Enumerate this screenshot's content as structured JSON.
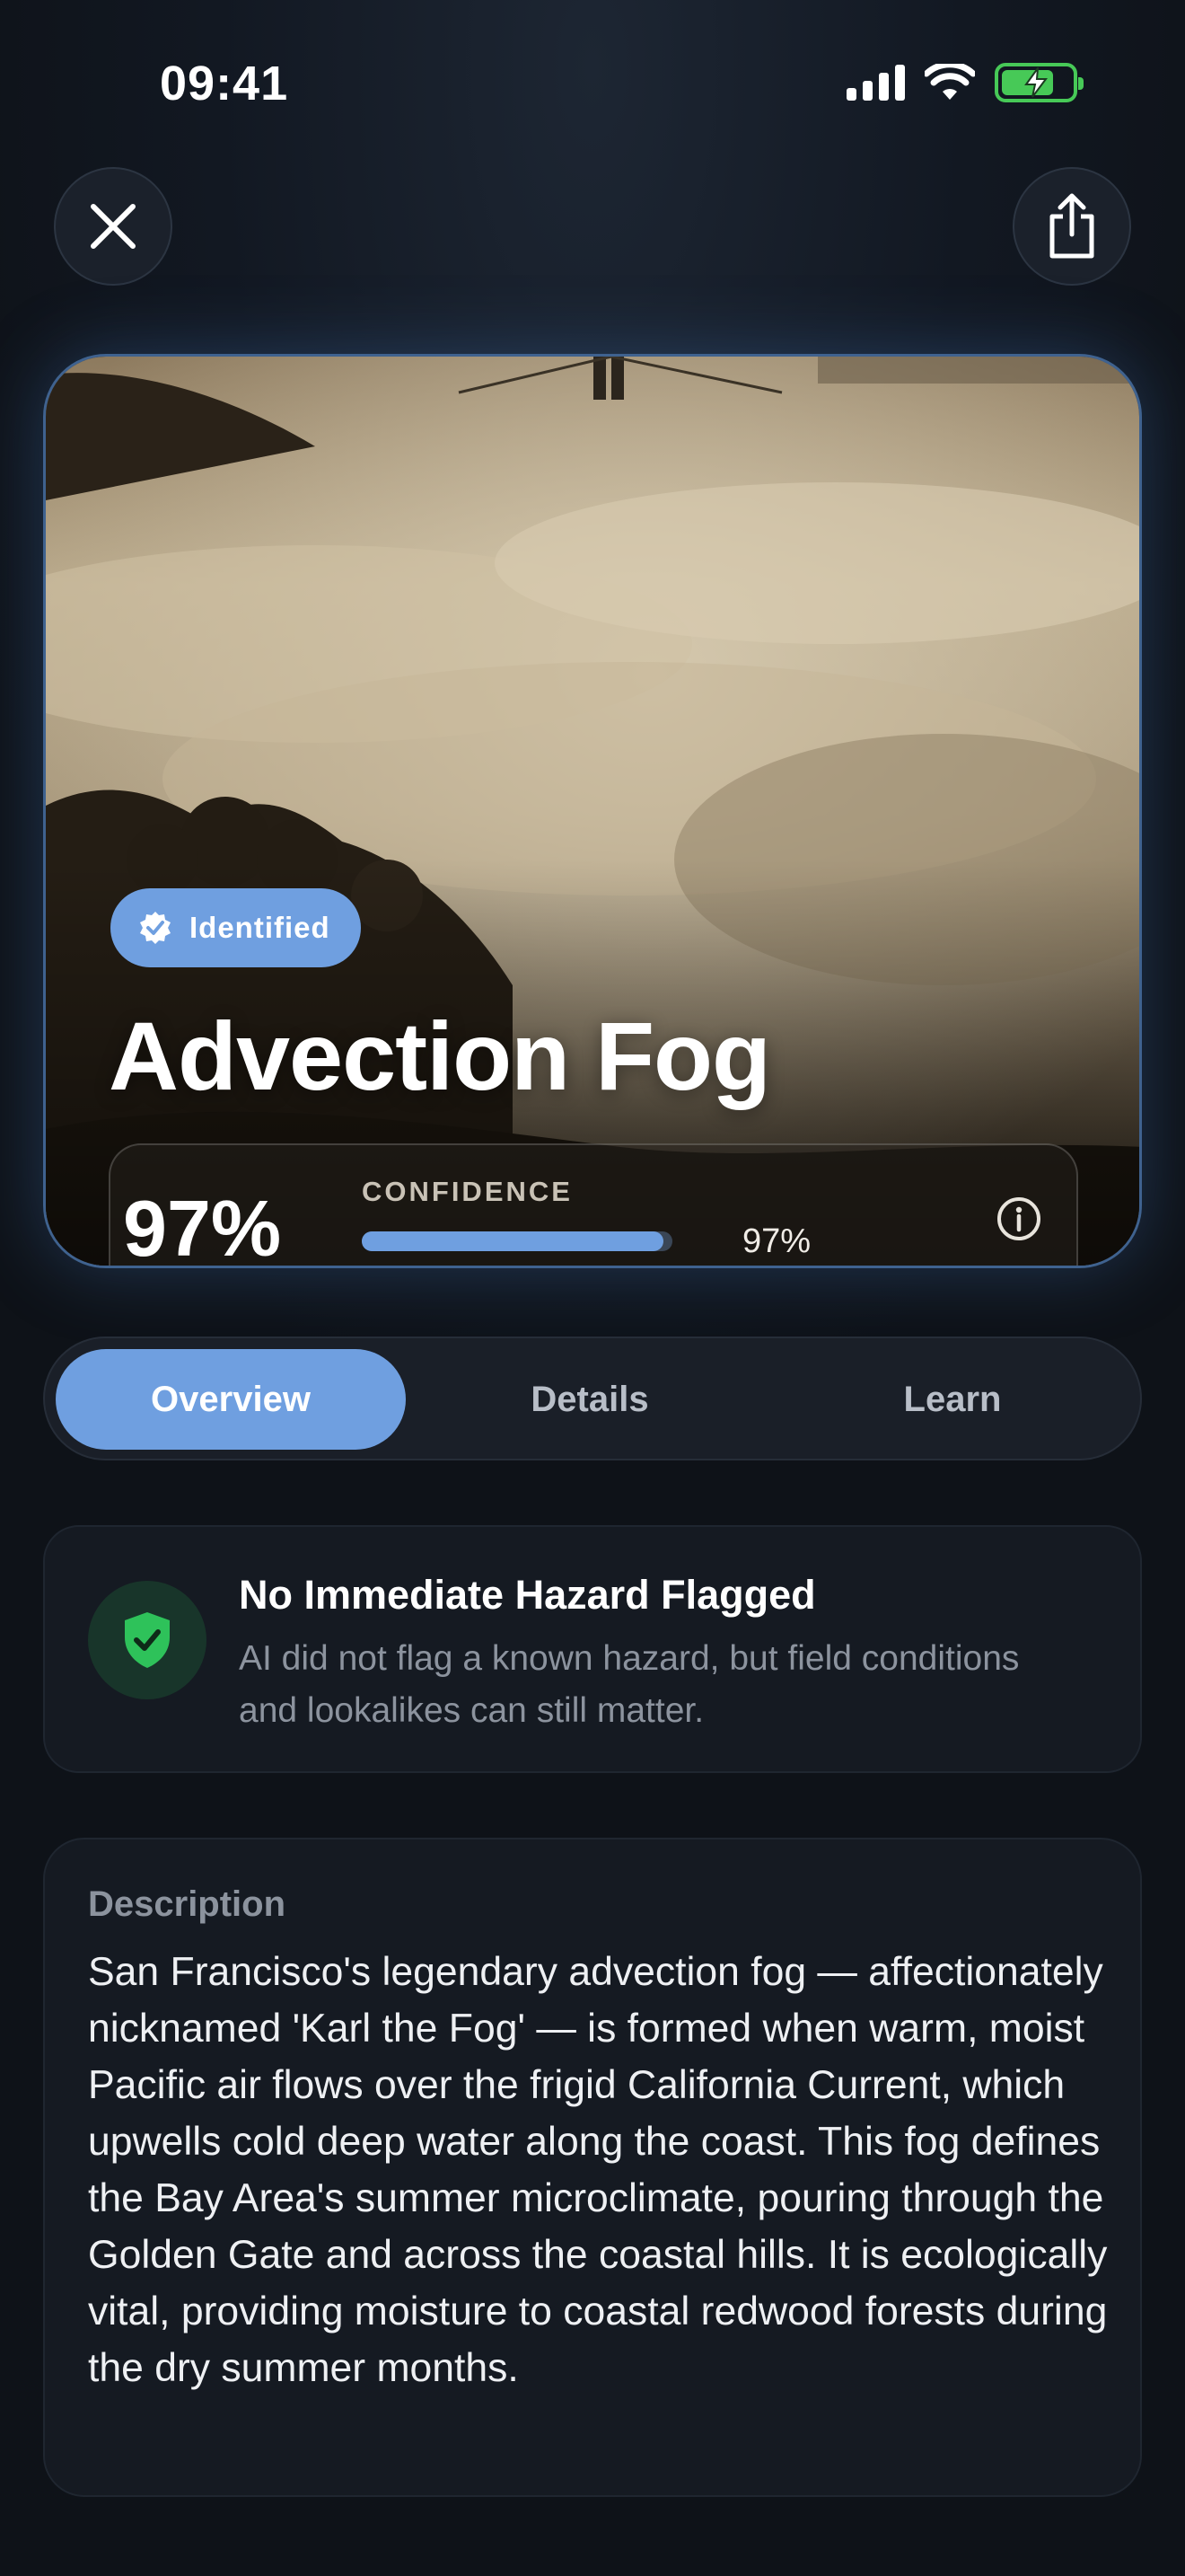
{
  "status_bar": {
    "time": "09:41"
  },
  "top_actions": {
    "close_icon": "close-icon",
    "share_icon": "share-icon"
  },
  "hero": {
    "badge": "Identified",
    "title": "Advection Fog",
    "confidence": {
      "value_text": "97%",
      "label": "CONFIDENCE",
      "percent": 97,
      "secondary_text": "97%"
    }
  },
  "tabs": [
    {
      "label": "Overview",
      "active": true
    },
    {
      "label": "Details",
      "active": false
    },
    {
      "label": "Learn",
      "active": false
    }
  ],
  "hazard": {
    "title": "No Immediate Hazard Flagged",
    "text": "AI did not flag a known hazard, but field conditions and lookalikes can still matter."
  },
  "description": {
    "label": "Description",
    "body": "San Francisco's legendary advection fog — affectionately nicknamed 'Karl the Fog' — is formed when warm, moist Pacific air flows over the frigid California Current, which upwells cold deep water along the coast. This fog defines the Bay Area's summer microclimate, pouring through the Golden Gate and across the coastal hills. It is ecologically vital, providing moisture to coastal redwood forests during the dry summer months."
  },
  "colors": {
    "accent": "#6f9fe0",
    "background": "#0e1218",
    "safe_green": "#2ec25a",
    "battery_green": "#47c957"
  }
}
